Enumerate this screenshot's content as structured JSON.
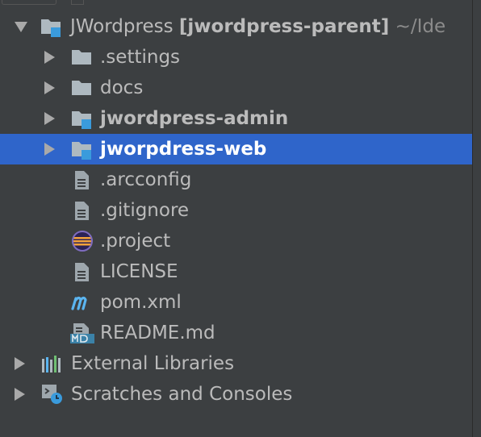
{
  "tree": {
    "root": {
      "name": "JWordpress",
      "module": "[jwordpress-parent]",
      "path": "~/Ide"
    },
    "items": [
      {
        "label": ".settings",
        "kind": "folder"
      },
      {
        "label": "docs",
        "kind": "folder"
      },
      {
        "label": "jwordpress-admin",
        "kind": "module"
      },
      {
        "label": "jworpdress-web",
        "kind": "module",
        "selected": true
      },
      {
        "label": ".arcconfig",
        "kind": "file"
      },
      {
        "label": ".gitignore",
        "kind": "file"
      },
      {
        "label": ".project",
        "kind": "eclipse-file"
      },
      {
        "label": "LICENSE",
        "kind": "file"
      },
      {
        "label": "pom.xml",
        "kind": "maven-file"
      },
      {
        "label": "README.md",
        "kind": "markdown-file"
      }
    ],
    "external_libraries": "External Libraries",
    "scratches": "Scratches and Consoles"
  },
  "colors": {
    "background": "#3c3f41",
    "selection": "#2f65ca",
    "text": "#bbbbbb",
    "module_marker": "#3a9bdc",
    "maven_icon": "#5bb5f0"
  },
  "icons": {
    "folder": "folder-icon",
    "module": "module-folder-icon",
    "file": "text-file-icon",
    "eclipse": "eclipse-project-icon",
    "maven": "maven-m-icon",
    "markdown": "markdown-file-icon",
    "libraries": "libraries-icon",
    "scratches": "scratches-console-icon"
  }
}
